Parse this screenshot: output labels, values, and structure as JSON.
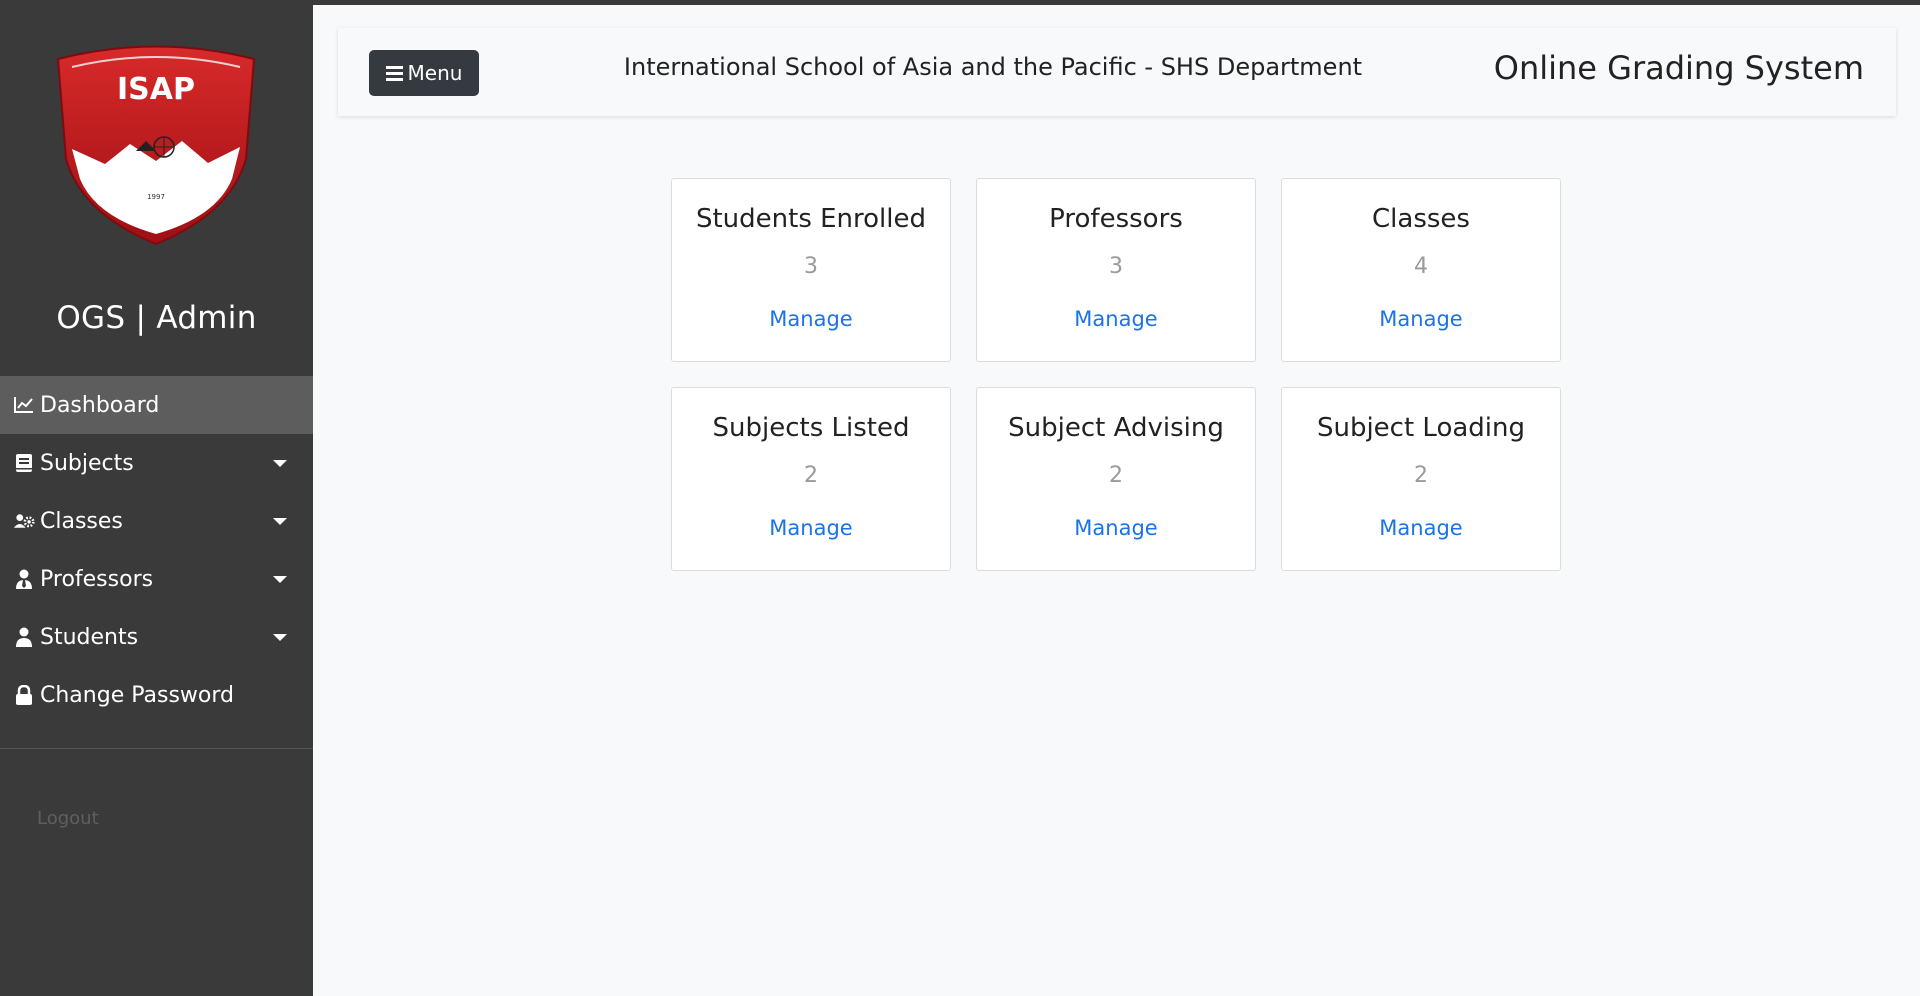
{
  "sidebar": {
    "logo_text": "ISAP",
    "logo_year": "1997",
    "brand": "OGS | Admin",
    "items": [
      {
        "label": "Dashboard",
        "icon": "chart-line-icon",
        "active": true,
        "has_caret": false
      },
      {
        "label": "Subjects",
        "icon": "book-icon",
        "active": false,
        "has_caret": true
      },
      {
        "label": "Classes",
        "icon": "users-cog-icon",
        "active": false,
        "has_caret": true
      },
      {
        "label": "Professors",
        "icon": "user-tie-icon",
        "active": false,
        "has_caret": true
      },
      {
        "label": "Students",
        "icon": "user-icon",
        "active": false,
        "has_caret": true
      },
      {
        "label": "Change Password",
        "icon": "lock-icon",
        "active": false,
        "has_caret": false
      }
    ],
    "logout_label": "Logout"
  },
  "header": {
    "menu_label": "Menu",
    "school_title": "International School of Asia and the Pacific - SHS Department",
    "system_title": "Online Grading System"
  },
  "cards": [
    {
      "title": "Students Enrolled",
      "count": "3",
      "link": "Manage"
    },
    {
      "title": "Professors",
      "count": "3",
      "link": "Manage"
    },
    {
      "title": "Classes",
      "count": "4",
      "link": "Manage"
    },
    {
      "title": "Subjects Listed",
      "count": "2",
      "link": "Manage"
    },
    {
      "title": "Subject Advising",
      "count": "2",
      "link": "Manage"
    },
    {
      "title": "Subject Loading",
      "count": "2",
      "link": "Manage"
    }
  ],
  "colors": {
    "sidebar_bg": "#3a3a3a",
    "active_item_bg": "#5d5d5d",
    "link_blue": "#1a73e8",
    "logo_red": "#b5121b",
    "menu_button_bg": "#343a40"
  }
}
